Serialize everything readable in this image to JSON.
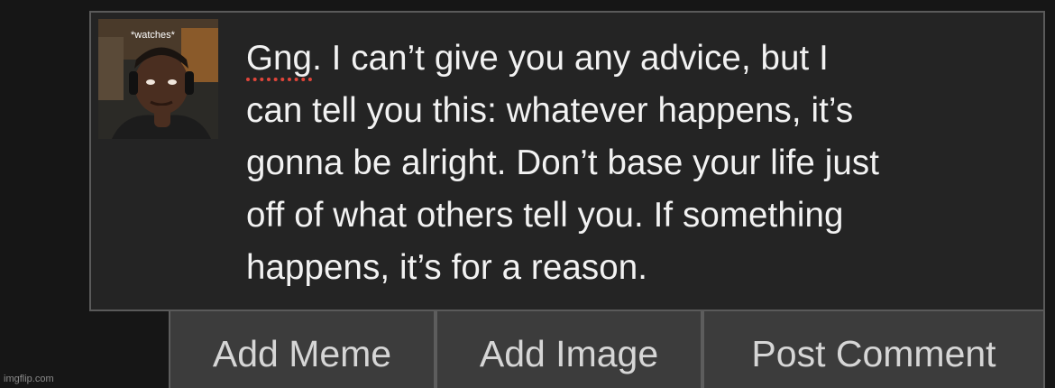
{
  "comment": {
    "first_word": "Gng",
    "body": ". I can’t give you any advice, but I\ncan tell you this: whatever happens, it’s\ngonna be alright. Don’t base your life just\noff of what others tell you. If something\nhappens, it’s for a reason.",
    "avatar_caption": "*watches*"
  },
  "actions": {
    "add_meme": "Add Meme",
    "add_image": "Add Image",
    "post_comment": "Post Comment"
  },
  "watermark": "imgflip.com",
  "colors": {
    "background": "#161616",
    "comment_box": "#242424",
    "button": "#3c3c3c",
    "spellcheck_underline": "#e0453a"
  },
  "icons": {
    "avatar": "user-avatar-image"
  }
}
